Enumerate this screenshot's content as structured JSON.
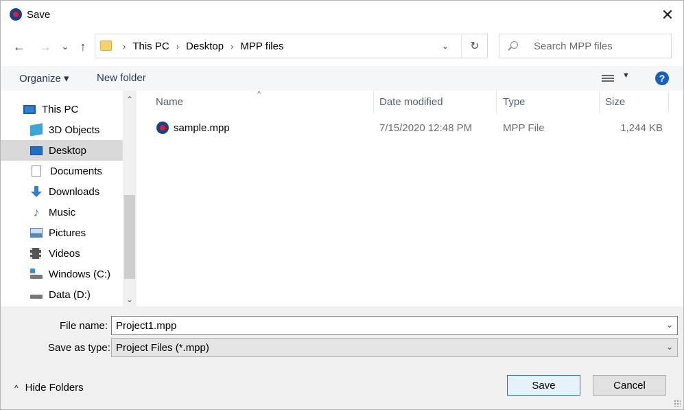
{
  "window": {
    "title": "Save",
    "close_glyph": "✕"
  },
  "nav": {
    "back": "←",
    "forward": "→",
    "recent": "⌄",
    "up": "↑"
  },
  "address": {
    "crumbs": [
      "This PC",
      "Desktop",
      "MPP files"
    ],
    "sep": "›",
    "dropdown": "⌄",
    "refresh": "↻"
  },
  "search": {
    "placeholder": "Search MPP files"
  },
  "toolbar": {
    "organize": "Organize ▾",
    "new_folder": "New folder",
    "view_drop": "▼",
    "help": "?"
  },
  "sidebar": {
    "items": [
      {
        "label": "This PC",
        "icon": "computer-icon",
        "color": "#2f7fd1"
      },
      {
        "label": "3D Objects",
        "icon": "cube-icon",
        "color": "#3ea6d6"
      },
      {
        "label": "Desktop",
        "icon": "desktop-icon",
        "color": "#1f6fc5",
        "selected": true
      },
      {
        "label": "Documents",
        "icon": "document-icon",
        "color": "#8a8a8a"
      },
      {
        "label": "Downloads",
        "icon": "download-icon",
        "color": "#2f7fd1"
      },
      {
        "label": "Music",
        "icon": "music-icon",
        "color": "#2f7fd1"
      },
      {
        "label": "Pictures",
        "icon": "pictures-icon",
        "color": "#5b87b8"
      },
      {
        "label": "Videos",
        "icon": "film-icon",
        "color": "#555555"
      },
      {
        "label": "Windows (C:)",
        "icon": "drive-icon",
        "color": "#3a8fd8"
      },
      {
        "label": "Data (D:)",
        "icon": "drive-icon",
        "color": "#777777"
      }
    ],
    "scroll_up": "⌃",
    "scroll_down": "⌄"
  },
  "list": {
    "columns": [
      "Name",
      "Date modified",
      "Type",
      "Size"
    ],
    "sort_caret": "^",
    "rows": [
      {
        "name": "sample.mpp",
        "date": "7/15/2020 12:48 PM",
        "type": "MPP File",
        "size": "1,244 KB"
      }
    ]
  },
  "form": {
    "filename_label": "File name:",
    "filename_value": "Project1.mpp",
    "savetype_label": "Save as type:",
    "savetype_value": "Project Files (*.mpp)",
    "dropdown": "⌄"
  },
  "footer": {
    "hide_folders": "Hide Folders",
    "hide_caret": "^",
    "save": "Save",
    "cancel": "Cancel"
  },
  "colors": {
    "accent": "#0078d7",
    "selected_bg": "#d9d9d9",
    "toolbar_bg": "#f5f6f7"
  }
}
